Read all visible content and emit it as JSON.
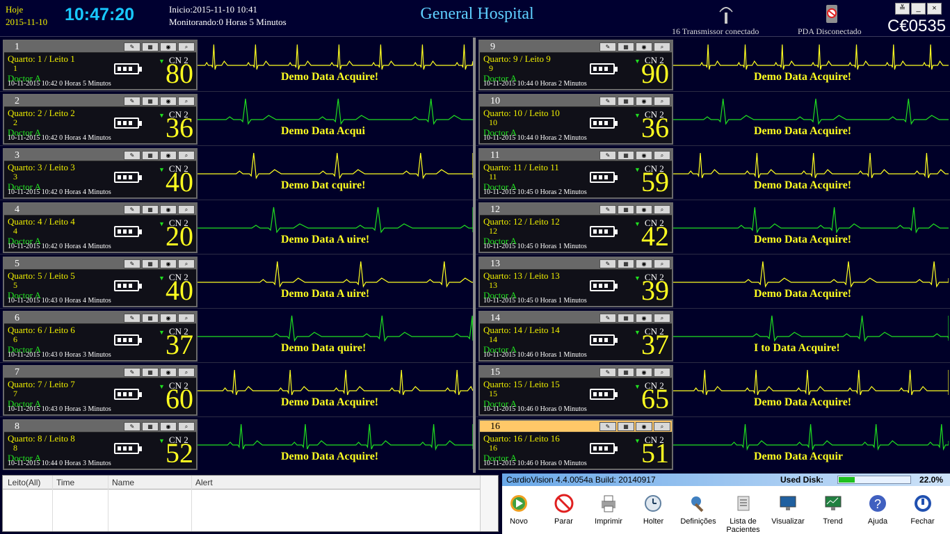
{
  "header": {
    "today_label": "Hoje",
    "date": "2015-11-10",
    "clock": "10:47:20",
    "inicio": "Inicio:2015-11-10 10:41",
    "monitorando": "Monitorando:0 Horas 5 Minutos",
    "title": "General Hospital",
    "transmitter_status": "16 Transmissor conectado",
    "pda_status": "PDA Disconectado",
    "ce_mark": "C€0535"
  },
  "window_controls": [
    "≚",
    "_",
    "×"
  ],
  "beds": [
    {
      "bed": "1",
      "quarto": "Quarto: 1 / Leito 1",
      "leito": "1",
      "doctor": "Doctor A",
      "dt": "10-11-2015  10:42  0 Horas 5 Minutos",
      "channel": "CN 2",
      "hr": "80",
      "demo": "Demo Data Acquire!",
      "color": "#ffff20"
    },
    {
      "bed": "2",
      "quarto": "Quarto: 2 / Leito 2",
      "leito": "2",
      "doctor": "Doctor A",
      "dt": "10-11-2015  10:42  0 Horas 4 Minutos",
      "channel": "CN 2",
      "hr": "36",
      "demo": "Demo Data Acqui",
      "color": "#20e020"
    },
    {
      "bed": "3",
      "quarto": "Quarto: 3 / Leito 3",
      "leito": "3",
      "doctor": "Doctor A",
      "dt": "10-11-2015  10:42  0 Horas 4 Minutos",
      "channel": "CN 2",
      "hr": "40",
      "demo": "Demo Dat  cquire!",
      "color": "#ffff20"
    },
    {
      "bed": "4",
      "quarto": "Quarto: 4 / Leito 4",
      "leito": "4",
      "doctor": "Doctor A",
      "dt": "10-11-2015  10:42  0 Horas 4 Minutos",
      "channel": "CN 2",
      "hr": "20",
      "demo": "Demo Data A  uire!",
      "color": "#20e020"
    },
    {
      "bed": "5",
      "quarto": "Quarto: 5 / Leito 5",
      "leito": "5",
      "doctor": "Doctor A",
      "dt": "10-11-2015  10:43  0 Horas 4 Minutos",
      "channel": "CN 2",
      "hr": "40",
      "demo": "Demo Data A  uire!",
      "color": "#ffff20"
    },
    {
      "bed": "6",
      "quarto": "Quarto: 6 / Leito 6",
      "leito": "6",
      "doctor": "Doctor A",
      "dt": "10-11-2015  10:43  0 Horas 3 Minutos",
      "channel": "CN 2",
      "hr": "37",
      "demo": "Demo Data     quire!",
      "color": "#20e020"
    },
    {
      "bed": "7",
      "quarto": "Quarto: 7 / Leito 7",
      "leito": "7",
      "doctor": "Doctor A",
      "dt": "10-11-2015  10:43  0 Horas 3 Minutos",
      "channel": "CN 2",
      "hr": "60",
      "demo": "Demo Data Acquire!",
      "color": "#ffff20"
    },
    {
      "bed": "8",
      "quarto": "Quarto: 8 / Leito 8",
      "leito": "8",
      "doctor": "Doctor A",
      "dt": "10-11-2015  10:44  0 Horas 3 Minutos",
      "channel": "CN 2",
      "hr": "52",
      "demo": "Demo Data Acquire!",
      "color": "#20e020"
    },
    {
      "bed": "9",
      "quarto": "Quarto: 9 / Leito 9",
      "leito": "9",
      "doctor": "Doctor A",
      "dt": "10-11-2015  10:44  0 Horas 2 Minutos",
      "channel": "CN 2",
      "hr": "90",
      "demo": "Demo Data Acquire!",
      "color": "#ffff20"
    },
    {
      "bed": "10",
      "quarto": "Quarto: 10 / Leito 10",
      "leito": "10",
      "doctor": "Doctor A",
      "dt": "10-11-2015  10:44  0 Horas 2 Minutos",
      "channel": "CN 2",
      "hr": "36",
      "demo": "Demo Data Acquire!",
      "color": "#20e020"
    },
    {
      "bed": "11",
      "quarto": "Quarto: 11 / Leito 11",
      "leito": "11",
      "doctor": "Doctor A",
      "dt": "10-11-2015  10:45  0 Horas 2 Minutos",
      "channel": "CN 2",
      "hr": "59",
      "demo": "Demo Data Acquire!",
      "color": "#ffff20"
    },
    {
      "bed": "12",
      "quarto": "Quarto: 12 / Leito 12",
      "leito": "12",
      "doctor": "Doctor A",
      "dt": "10-11-2015  10:45  0 Horas 1 Minutos",
      "channel": "CN 2",
      "hr": "42",
      "demo": "Demo Data Acquire!",
      "color": "#20e020"
    },
    {
      "bed": "13",
      "quarto": "Quarto: 13 / Leito 13",
      "leito": "13",
      "doctor": "Doctor A",
      "dt": "10-11-2015  10:45  0 Horas 1 Minutos",
      "channel": "CN 2",
      "hr": "39",
      "demo": "Demo Data Acquire!",
      "color": "#ffff20"
    },
    {
      "bed": "14",
      "quarto": "Quarto: 14 / Leito 14",
      "leito": "14",
      "doctor": "Doctor A",
      "dt": "10-11-2015  10:46  0 Horas 1 Minutos",
      "channel": "CN 2",
      "hr": "37",
      "demo": "I   to Data Acquire!",
      "color": "#20e020"
    },
    {
      "bed": "15",
      "quarto": "Quarto: 15 / Leito 15",
      "leito": "15",
      "doctor": "Doctor A",
      "dt": "10-11-2015  10:46  0 Horas 0 Minutos",
      "channel": "CN 2",
      "hr": "65",
      "demo": "Demo Data Acquire!",
      "color": "#ffff20"
    },
    {
      "bed": "16",
      "quarto": "Quarto: 16 / Leito 16",
      "leito": "16",
      "doctor": "Doctor A",
      "dt": "10-11-2015  10:46  0 Horas 0 Minutos",
      "channel": "CN 2",
      "hr": "51",
      "demo": "Demo Data Acquir",
      "color": "#20e020",
      "selected": true
    }
  ],
  "alerts": {
    "columns": [
      "Leito(All)",
      "Time",
      "Name",
      "Alert"
    ]
  },
  "info": {
    "version": "CardioVision 4.4.0054a   Build: 20140917",
    "used_disk_label": "Used Disk:",
    "used_disk_fraction": 0.22,
    "used_disk_pct": "22.0%"
  },
  "toolbar": [
    {
      "label": "Novo",
      "icon": "play-icon"
    },
    {
      "label": "Parar",
      "icon": "stop-icon"
    },
    {
      "label": "Imprimir",
      "icon": "printer-icon"
    },
    {
      "label": "Holter",
      "icon": "holter-icon"
    },
    {
      "label": "Definições",
      "icon": "settings-tools-icon"
    },
    {
      "label": "Lista de Pacientes",
      "icon": "patient-list-icon"
    },
    {
      "label": "Visualizar",
      "icon": "monitor-view-icon"
    },
    {
      "label": "Trend",
      "icon": "trend-monitor-icon"
    },
    {
      "label": "Ajuda",
      "icon": "help-icon"
    },
    {
      "label": "Fechar",
      "icon": "power-icon"
    }
  ]
}
